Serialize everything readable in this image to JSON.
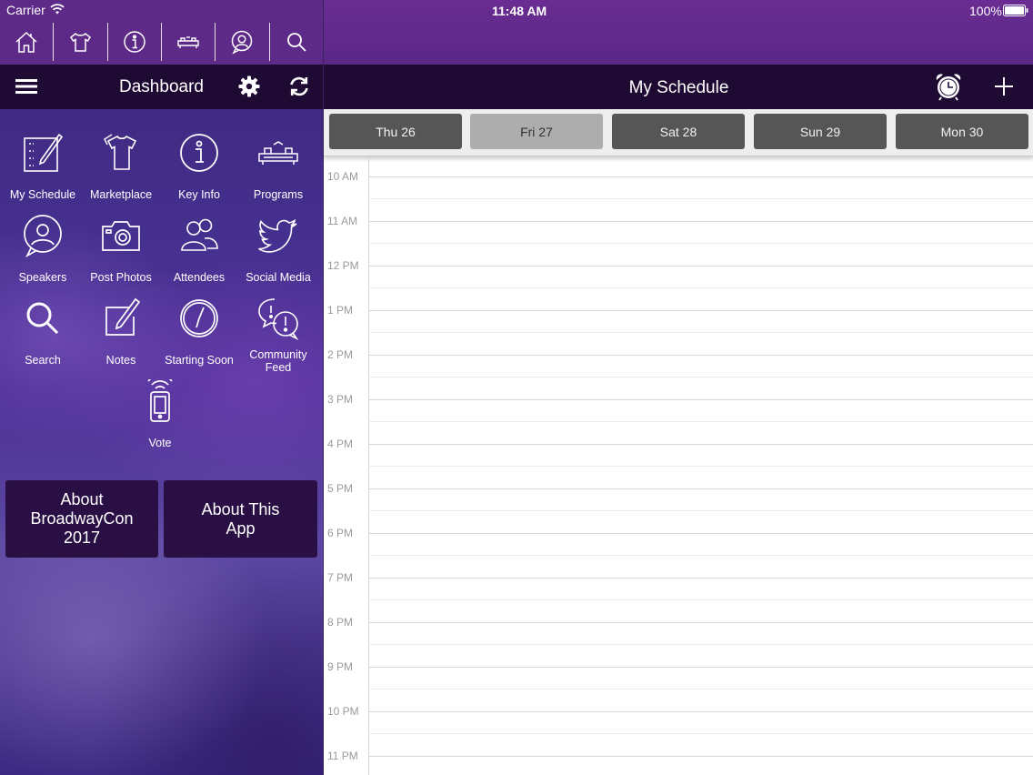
{
  "status_bar": {
    "carrier": "Carrier",
    "time": "11:48 AM",
    "battery": "100%"
  },
  "top_nav": {
    "icons": [
      "home-icon",
      "tshirt-icon",
      "info-icon",
      "programs-icon",
      "speaker-icon",
      "search-icon"
    ]
  },
  "dashboard": {
    "title": "Dashboard",
    "tiles": [
      {
        "label": "My Schedule",
        "icon": "schedule-icon"
      },
      {
        "label": "Marketplace",
        "icon": "tshirt-icon"
      },
      {
        "label": "Key Info",
        "icon": "info-icon"
      },
      {
        "label": "Programs",
        "icon": "programs-icon"
      },
      {
        "label": "Speakers",
        "icon": "speaker-icon"
      },
      {
        "label": "Post Photos",
        "icon": "camera-icon"
      },
      {
        "label": "Attendees",
        "icon": "attendees-icon"
      },
      {
        "label": "Social Media",
        "icon": "twitter-icon"
      },
      {
        "label": "Search",
        "icon": "search-icon"
      },
      {
        "label": "Notes",
        "icon": "notes-icon"
      },
      {
        "label": "Starting Soon",
        "icon": "clock-icon"
      },
      {
        "label": "Community Feed",
        "icon": "community-icon"
      },
      {
        "label": "Vote",
        "icon": "vote-icon"
      }
    ],
    "about_buttons": [
      "About BroadwayCon 2017",
      "About This App"
    ]
  },
  "schedule": {
    "title": "My Schedule",
    "days": [
      {
        "label": "Thu 26",
        "selected": false
      },
      {
        "label": "Fri 27",
        "selected": true
      },
      {
        "label": "Sat 28",
        "selected": false
      },
      {
        "label": "Sun 29",
        "selected": false
      },
      {
        "label": "Mon 30",
        "selected": false
      }
    ],
    "hours": [
      "10 AM",
      "11 AM",
      "12 PM",
      "1 PM",
      "2 PM",
      "3 PM",
      "4 PM",
      "5 PM",
      "6 PM",
      "7 PM",
      "8 PM",
      "9 PM",
      "10 PM",
      "11 PM"
    ]
  },
  "colors": {
    "header_purple": "#5e2a88",
    "bar_dark": "#1f0a33",
    "day_button": "#565656",
    "day_button_selected": "#adadad"
  }
}
